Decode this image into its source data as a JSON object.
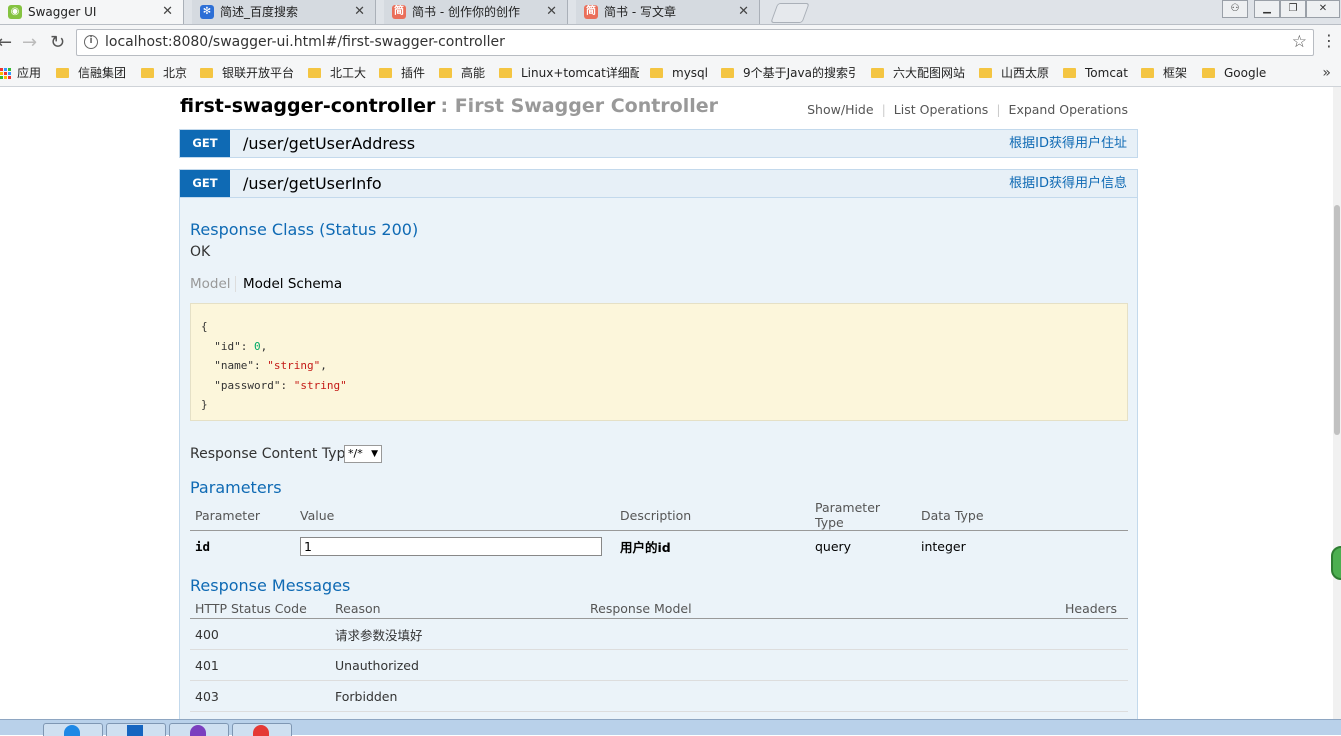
{
  "browser": {
    "tabs": [
      {
        "title": "Swagger UI",
        "favicon_color": "#85c341",
        "active": true
      },
      {
        "title": "简述_百度搜索",
        "favicon_color": "#2d6fd6",
        "active": false
      },
      {
        "title": "简书 - 创作你的创作",
        "favicon_color": "#ea6f5a",
        "active": false
      },
      {
        "title": "简书 - 写文章",
        "favicon_color": "#ea6f5a",
        "active": false
      }
    ],
    "url": "localhost:8080/swagger-ui.html#/first-swagger-controller",
    "bookmarks": {
      "apps": "应用",
      "items": [
        "信融集团",
        "北京",
        "银联开放平台",
        "北工大",
        "插件",
        "高能",
        "Linux+tomcat详细配",
        "mysql",
        "9个基于Java的搜索引",
        "六大配图网站",
        "山西太原",
        "Tomcat",
        "框架",
        "Google"
      ]
    }
  },
  "controller": {
    "name": "first-swagger-controller",
    "description": ": First Swagger Controller",
    "links": [
      "Show/Hide",
      "List Operations",
      "Expand Operations"
    ]
  },
  "operations": [
    {
      "method": "GET",
      "path": "/user/getUserAddress",
      "summary": "根据ID获得用户住址"
    },
    {
      "method": "GET",
      "path": "/user/getUserInfo",
      "summary": "根据ID获得用户信息"
    }
  ],
  "details": {
    "response_class_title": "Response Class (Status 200)",
    "response_class_value": "OK",
    "model_tab": "Model",
    "model_schema_tab": "Model Schema",
    "schema": {
      "open": "{",
      "id_key": "\"id\"",
      "id_val": "0",
      "name_key": "\"name\"",
      "name_val": "\"string\"",
      "password_key": "\"password\"",
      "password_val": "\"string\"",
      "close": "}"
    },
    "content_type_label": "Response Content Type",
    "content_type_value": "*/*",
    "parameters_title": "Parameters",
    "param_headers": [
      "Parameter",
      "Value",
      "Description",
      "Parameter Type",
      "Data Type"
    ],
    "params": [
      {
        "name": "id",
        "value": "1",
        "description": "用户的id",
        "param_type": "query",
        "data_type": "integer"
      }
    ],
    "messages_title": "Response Messages",
    "message_headers": [
      "HTTP Status Code",
      "Reason",
      "Response Model",
      "Headers"
    ],
    "messages": [
      {
        "code": "400",
        "reason": "请求参数没填好"
      },
      {
        "code": "401",
        "reason": "Unauthorized"
      },
      {
        "code": "403",
        "reason": "Forbidden"
      }
    ]
  },
  "colors": {
    "get_verb": "#0f6ab4",
    "op_bg": "#e7f0f7",
    "schema_bg": "#fcf6db"
  }
}
